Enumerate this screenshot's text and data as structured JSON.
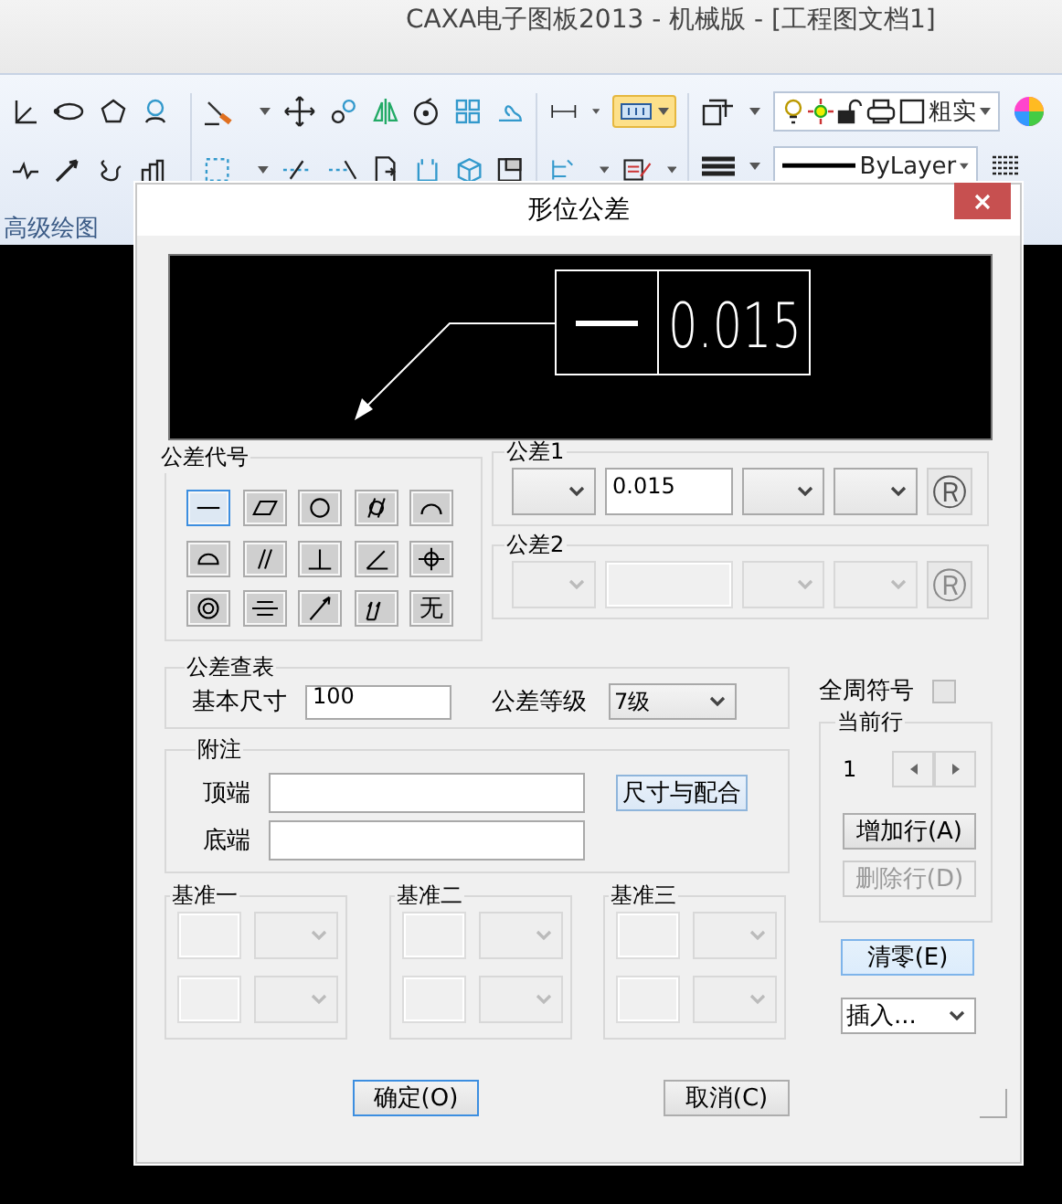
{
  "app": {
    "title": "CAXA电子图板2013 - 机械版 - [工程图文档1]",
    "ribbon": {
      "line_type": "粗实",
      "line_style": "ByLayer",
      "panel_label": "高级绘图"
    }
  },
  "dialog": {
    "title": "形位公差",
    "preview": {
      "kind": "straightness",
      "value": "0.015"
    },
    "symbol_group": {
      "label": "公差代号",
      "symbols": [
        {
          "kind": "straightness",
          "selected": true
        },
        {
          "kind": "flatness",
          "selected": false
        },
        {
          "kind": "circularity",
          "selected": false
        },
        {
          "kind": "cylindricity",
          "selected": false
        },
        {
          "kind": "profile_line",
          "selected": false
        },
        {
          "kind": "profile_surface",
          "selected": false
        },
        {
          "kind": "parallelism",
          "selected": false
        },
        {
          "kind": "perpendicularity",
          "selected": false
        },
        {
          "kind": "angularity",
          "selected": false
        },
        {
          "kind": "position",
          "selected": false
        },
        {
          "kind": "concentricity",
          "selected": false
        },
        {
          "kind": "symmetry",
          "selected": false
        },
        {
          "kind": "circular_runout",
          "selected": false
        },
        {
          "kind": "total_runout",
          "selected": false
        },
        {
          "kind": "none",
          "label": "无",
          "selected": false
        }
      ]
    },
    "tolerances": [
      {
        "label": "公差1",
        "disabled": false,
        "value": "0.015",
        "modifier": "Ⓡ"
      },
      {
        "label": "公差2",
        "disabled": true,
        "modifier": "Ⓡ"
      }
    ],
    "lookup": {
      "label": "公差查表",
      "size_label": "基本尺寸",
      "size": "100",
      "grade_label": "公差等级",
      "grade": "7级"
    },
    "all_around": {
      "label": "全周符号",
      "checked": false
    },
    "note": {
      "label": "附注",
      "top_label": "顶端",
      "bottom_label": "底端",
      "fit_button": "尺寸与配合"
    },
    "current_row": {
      "label": "当前行",
      "value": "1",
      "add": {
        "label": "增加行(A)",
        "disabled": false
      },
      "delete": {
        "label": "删除行(D)",
        "disabled": true
      }
    },
    "datums": [
      {
        "label": "基准一",
        "disabled": true
      },
      {
        "label": "基准二",
        "disabled": true
      },
      {
        "label": "基准三",
        "disabled": true
      }
    ],
    "clear_button": {
      "label": "清零(E)",
      "highlighted": true
    },
    "insert": "插入...",
    "buttons": [
      {
        "label": "确定(O)",
        "default": true
      },
      {
        "label": "取消(C)",
        "default": false
      }
    ]
  }
}
